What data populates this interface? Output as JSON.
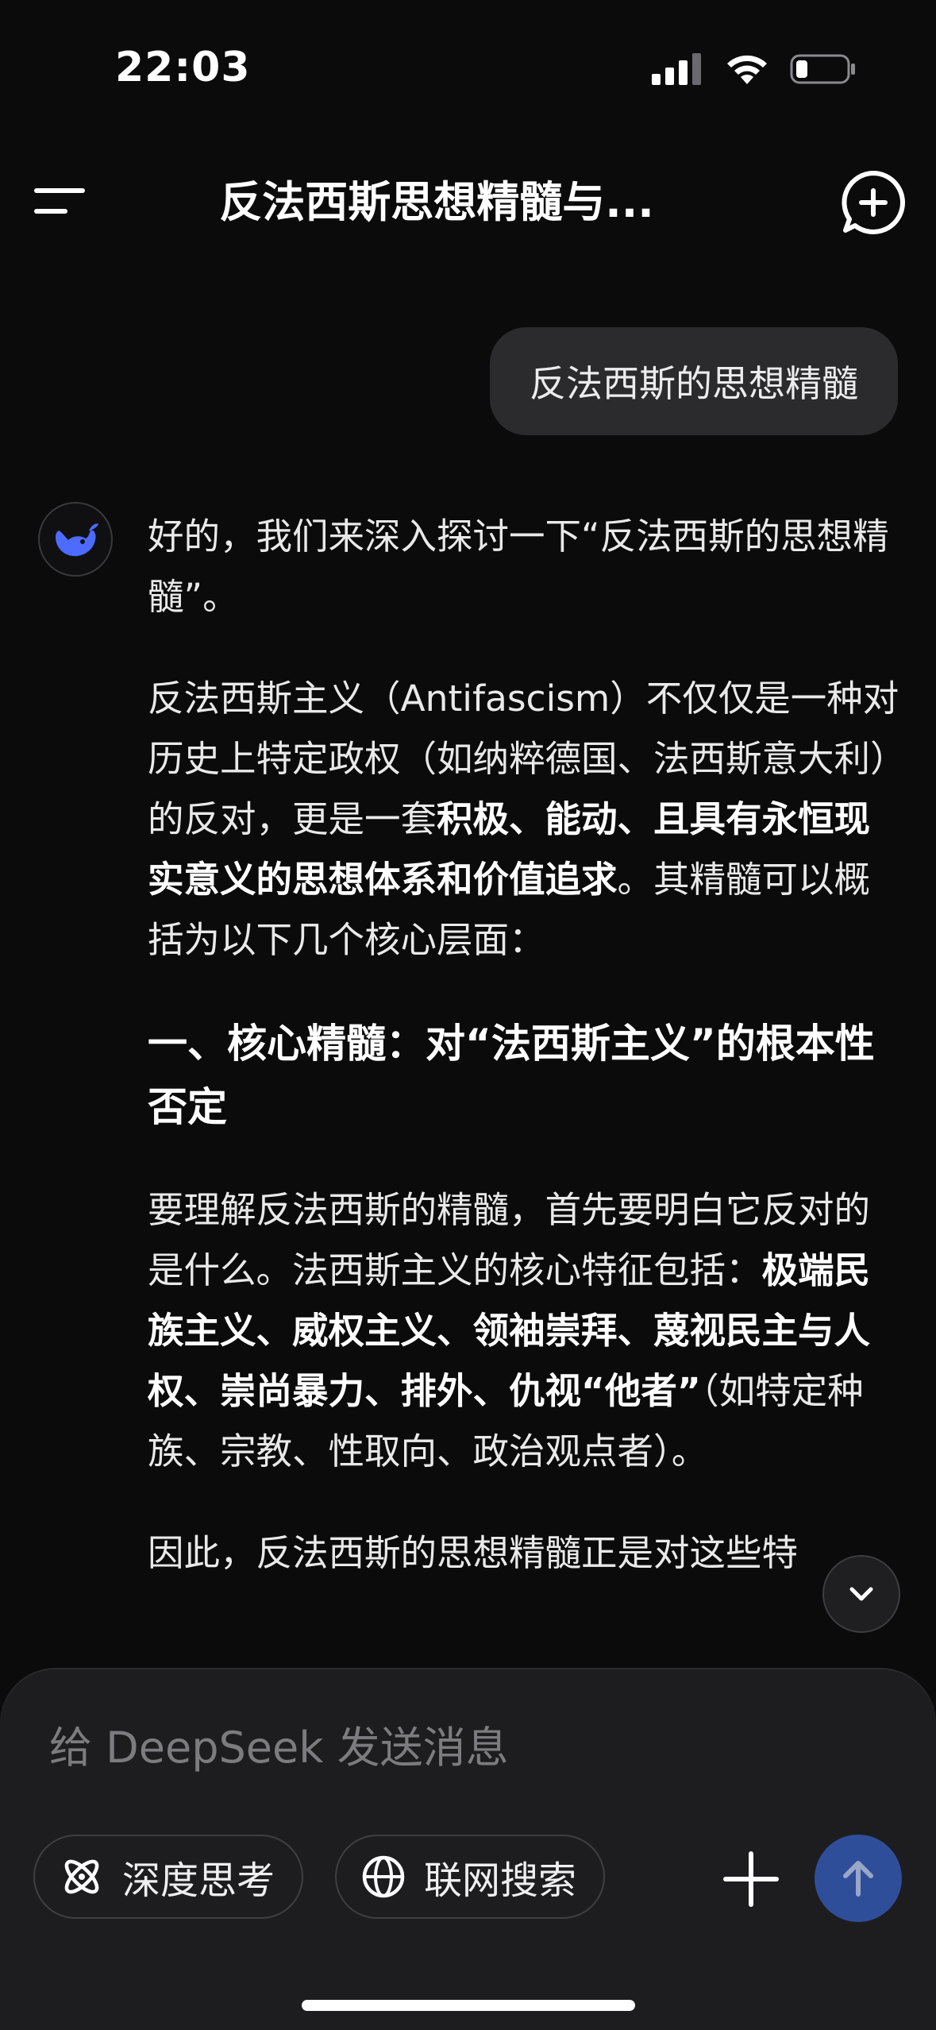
{
  "status_bar": {
    "time": "22:03"
  },
  "nav": {
    "title": "反法西斯思想精髓与..."
  },
  "user_message": "反法西斯的思想精髓",
  "assistant": {
    "p1": "好的，我们来深入探讨一下“反法西斯的思想精髓”。",
    "p2_start": "反法西斯主义（Antifascism）不仅仅是一种对历史上特定政权（如纳粹德国、法西斯意大利）的反对，更是一套",
    "p2_bold": "积极、能动、且具有永恒现实意义的思想体系和价值追求",
    "p2_end": "。其精髓可以概括为以下几个核心层面：",
    "h1": "一、核心精髓：对“法西斯主义”的根本性否定",
    "p3_start": "要理解反法西斯的精髓，首先要明白它反对的是什么。法西斯主义的核心特征包括：",
    "p3_bold": "极端民族主义、威权主义、领袖崇拜、蔑视民主与人权、崇尚暴力、排外、仇视“他者”",
    "p3_end": "（如特定种族、宗教、性取向、政治观点者）。",
    "p4": "因此，反法西斯的思想精髓正是对这些特"
  },
  "composer": {
    "placeholder": "给 DeepSeek 发送消息",
    "deep_think_label": "深度思考",
    "web_search_label": "联网搜索"
  },
  "icons": {
    "menu": "menu-icon",
    "new_chat": "new-chat-icon",
    "avatar": "deepseek-whale-icon",
    "scroll_down": "chevron-down-icon",
    "deep_think": "atom-icon",
    "web_search": "globe-icon",
    "plus": "plus-icon",
    "send": "arrow-up-icon"
  },
  "colors": {
    "background": "#0b0b0c",
    "bubble": "#2b2b2e",
    "composer": "#1d1d20",
    "accent": "#4d6bfe",
    "send_button": "#2f4e9a"
  }
}
